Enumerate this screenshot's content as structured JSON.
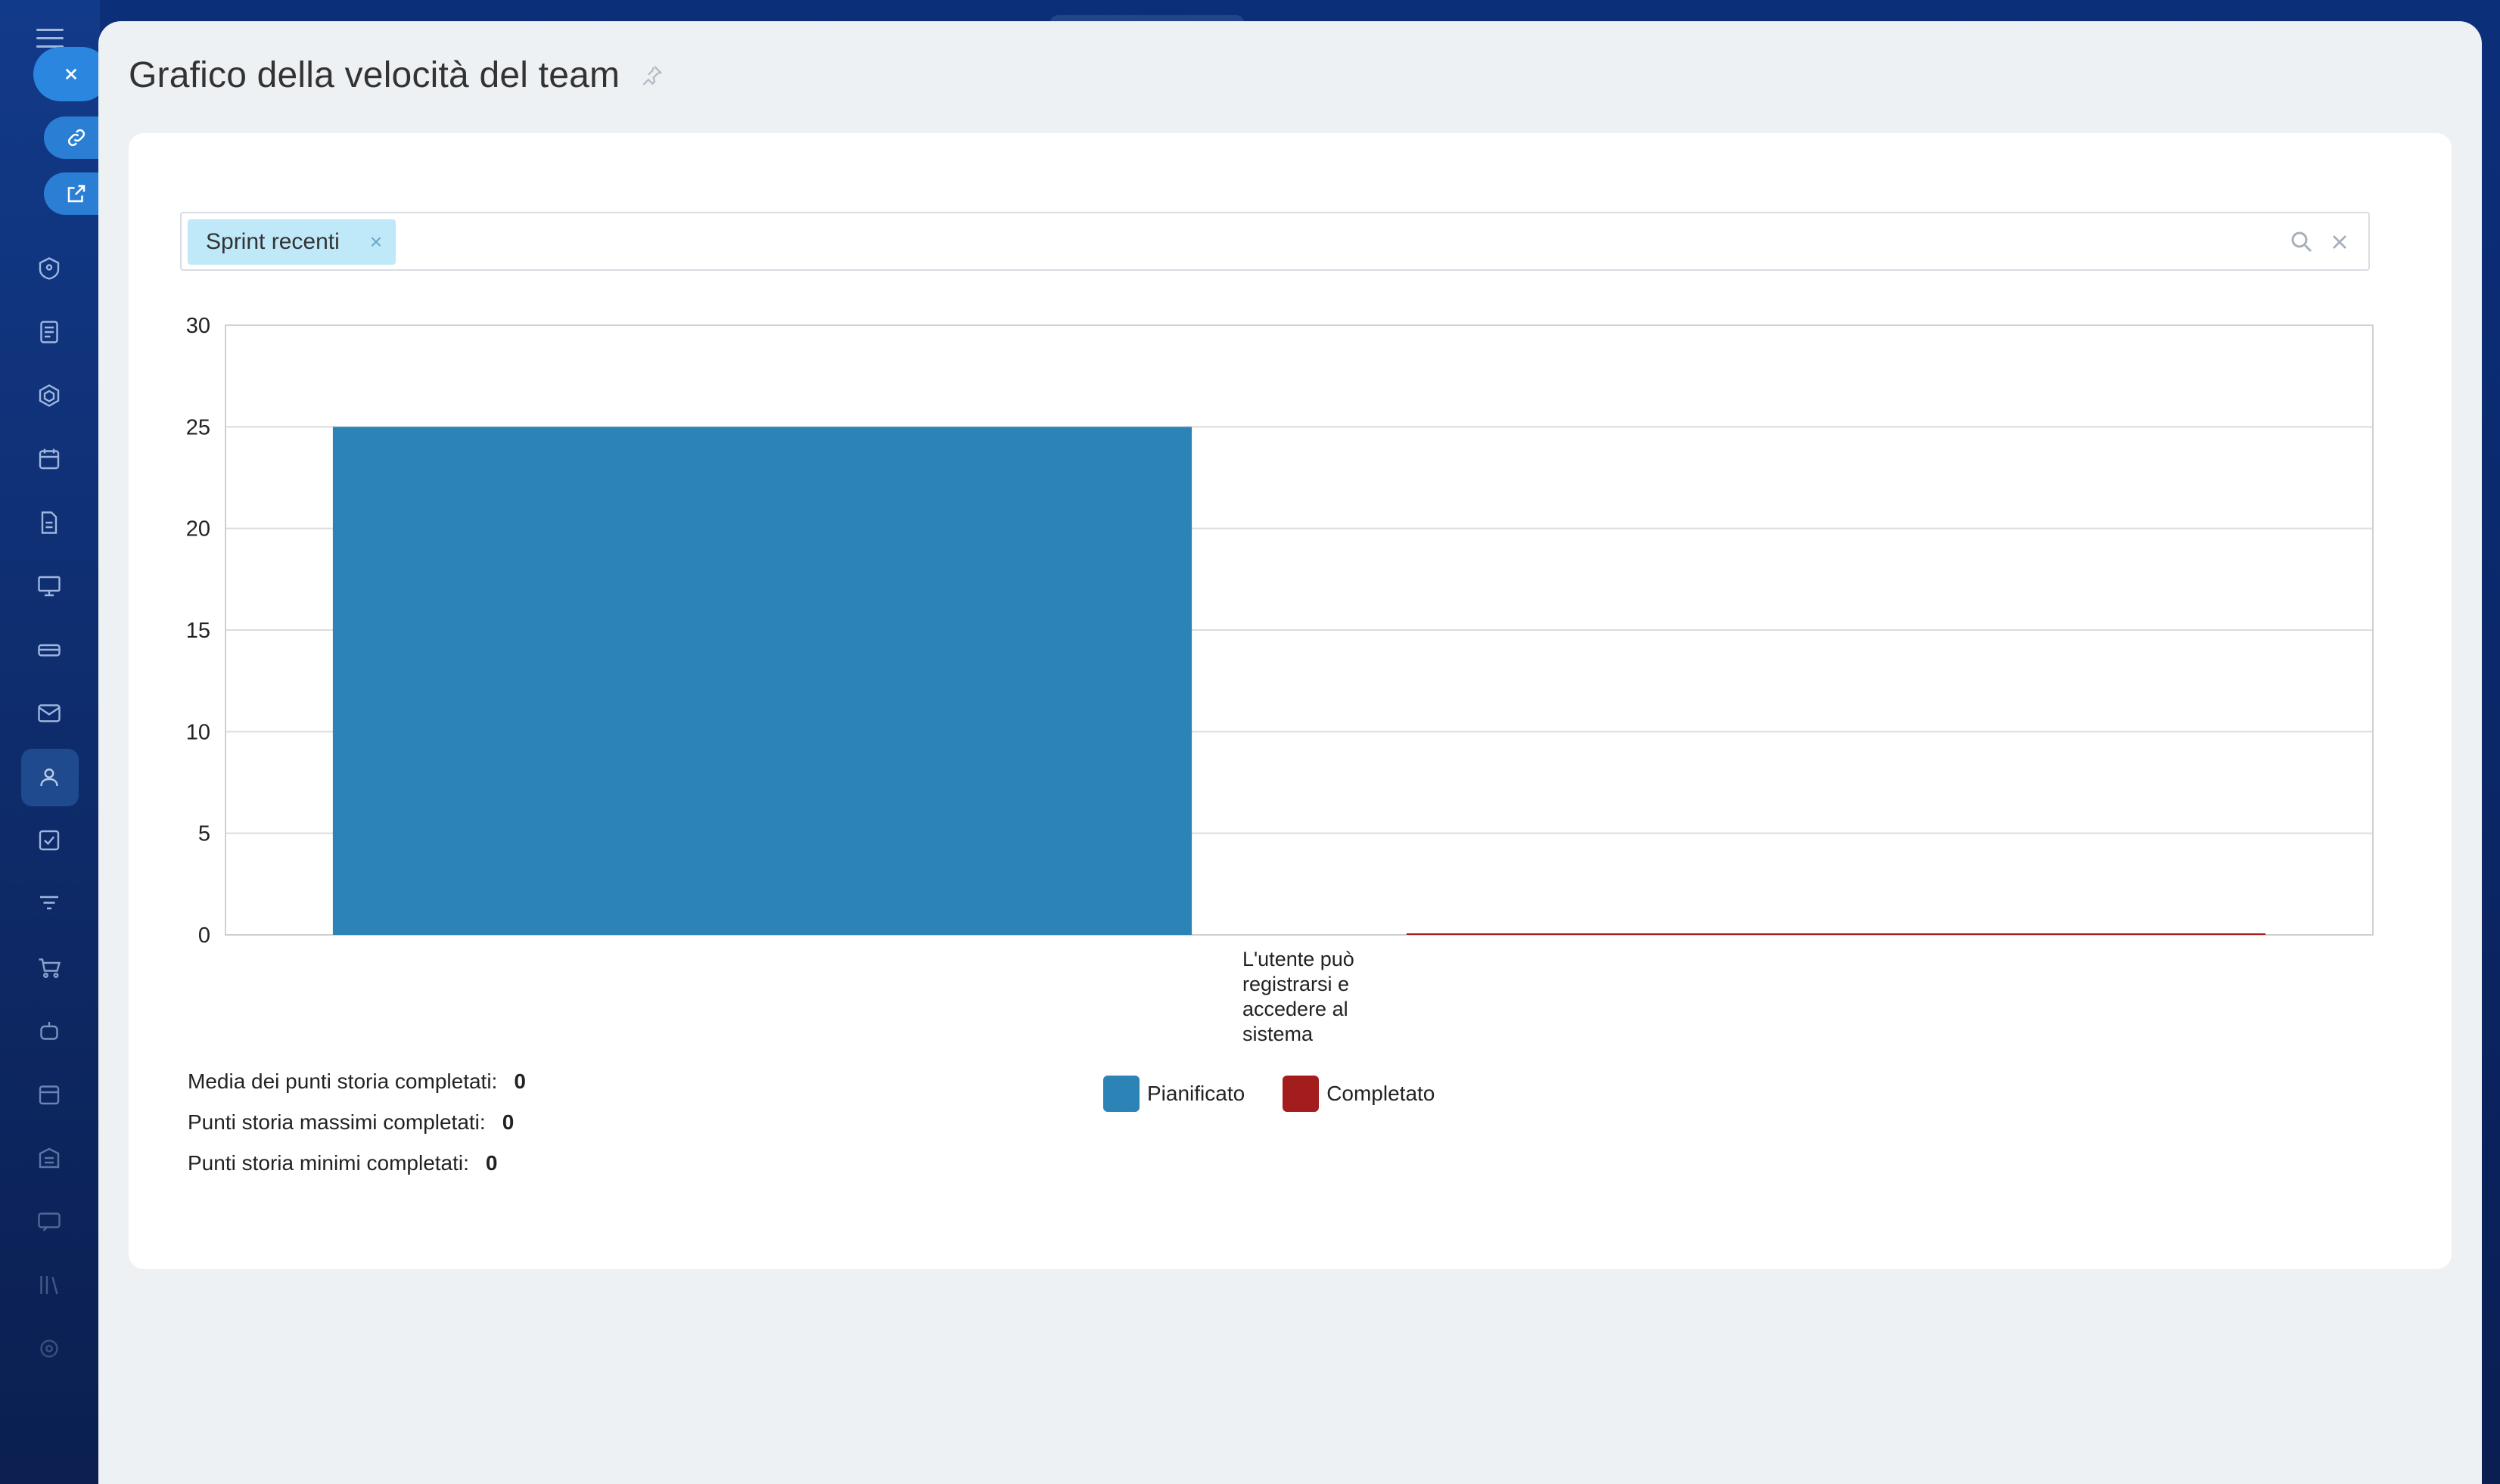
{
  "page": {
    "title": "Grafico della velocità del team"
  },
  "filter": {
    "tag_label": "Sprint recenti",
    "tag_remove": "×"
  },
  "chart_data": {
    "type": "bar",
    "categories": [
      "L'utente può registrarsi e accedere al sistema"
    ],
    "series": [
      {
        "name": "Pianificato",
        "values": [
          25
        ],
        "color": "#2b83b6"
      },
      {
        "name": "Completato",
        "values": [
          0
        ],
        "color": "#a31d1d"
      }
    ],
    "ylim": [
      0,
      30
    ],
    "yticks": [
      0,
      5,
      10,
      15,
      20,
      25,
      30
    ],
    "grid": true,
    "legend_position": "bottom-center"
  },
  "x_category_lines": [
    "L'utente può",
    "registrarsi e",
    "accedere al",
    "sistema"
  ],
  "stats": [
    {
      "label": "Media dei punti storia completati:",
      "value": "0"
    },
    {
      "label": "Punti storia massimi completati:",
      "value": "0"
    },
    {
      "label": "Punti storia minimi completati:",
      "value": "0"
    }
  ],
  "legend": [
    {
      "label": "Pianificato",
      "color": "#2b83b6"
    },
    {
      "label": "Completato",
      "color": "#a31d1d"
    }
  ],
  "icons": {
    "close": "close-icon",
    "link": "link-icon",
    "external": "external-link-icon",
    "pin": "pin-icon",
    "search": "search-icon",
    "clear": "clear-icon"
  }
}
